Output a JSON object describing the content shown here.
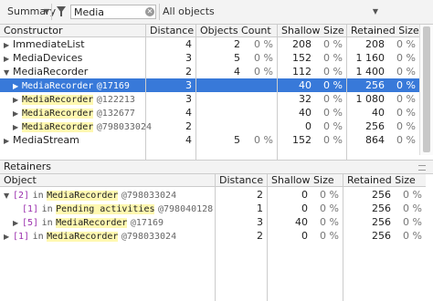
{
  "toolbar": {
    "view": "Summary",
    "filter_value": "Media",
    "class_filter": "All objects"
  },
  "constructors": {
    "headers": {
      "constructor": "Constructor",
      "distance": "Distance",
      "objects_count": "Objects Count",
      "shallow_size": "Shallow Size",
      "retained_size": "Retained Size"
    },
    "rows": [
      {
        "indent": 0,
        "expander": "▶",
        "name": "ImmediateList",
        "highlight": "",
        "addr": "",
        "distance": "4",
        "count": "2",
        "count_pct": "0 %",
        "shallow": "208",
        "shallow_pct": "0 %",
        "retained": "208",
        "retained_pct": "0 %",
        "selected": false
      },
      {
        "indent": 0,
        "expander": "▶",
        "name": "MediaDevices",
        "highlight": "",
        "addr": "",
        "distance": "3",
        "count": "5",
        "count_pct": "0 %",
        "shallow": "152",
        "shallow_pct": "0 %",
        "retained": "1 160",
        "retained_pct": "0 %",
        "selected": false
      },
      {
        "indent": 0,
        "expander": "▼",
        "name": "MediaRecorder",
        "highlight": "",
        "addr": "",
        "distance": "2",
        "count": "4",
        "count_pct": "0 %",
        "shallow": "112",
        "shallow_pct": "0 %",
        "retained": "1 400",
        "retained_pct": "0 %",
        "selected": false
      },
      {
        "indent": 1,
        "expander": "▶",
        "name": "",
        "highlight": "MediaRecorder",
        "addr": "@17169",
        "distance": "3",
        "count": "",
        "count_pct": "",
        "shallow": "40",
        "shallow_pct": "0 %",
        "retained": "256",
        "retained_pct": "0 %",
        "selected": true
      },
      {
        "indent": 1,
        "expander": "▶",
        "name": "",
        "highlight": "MediaRecorder",
        "addr": "@122213",
        "distance": "3",
        "count": "",
        "count_pct": "",
        "shallow": "32",
        "shallow_pct": "0 %",
        "retained": "1 080",
        "retained_pct": "0 %",
        "selected": false
      },
      {
        "indent": 1,
        "expander": "▶",
        "name": "",
        "highlight": "MediaRecorder",
        "addr": "@132677",
        "distance": "4",
        "count": "",
        "count_pct": "",
        "shallow": "40",
        "shallow_pct": "0 %",
        "retained": "40",
        "retained_pct": "0 %",
        "selected": false
      },
      {
        "indent": 1,
        "expander": "▶",
        "name": "",
        "highlight": "MediaRecorder",
        "addr": "@798033024",
        "distance": "2",
        "count": "",
        "count_pct": "",
        "shallow": "0",
        "shallow_pct": "0 %",
        "retained": "256",
        "retained_pct": "0 %",
        "selected": false
      },
      {
        "indent": 0,
        "expander": "▶",
        "name": "MediaStream",
        "highlight": "",
        "addr": "",
        "distance": "4",
        "count": "5",
        "count_pct": "0 %",
        "shallow": "152",
        "shallow_pct": "0 %",
        "retained": "864",
        "retained_pct": "0 %",
        "selected": false
      }
    ]
  },
  "retainers": {
    "title": "Retainers",
    "headers": {
      "object": "Object",
      "distance": "Distance",
      "shallow_size": "Shallow Size",
      "retained_size": "Retained Size"
    },
    "rows": [
      {
        "indent": 0,
        "expander": "▼",
        "index": "[2]",
        "in": "in",
        "highlight": "MediaRecorder",
        "addr": "@798033024",
        "distance": "2",
        "shallow": "0",
        "shallow_pct": "0 %",
        "retained": "256",
        "retained_pct": "0 %"
      },
      {
        "indent": 1,
        "expander": "",
        "index": "[1]",
        "in": "in",
        "highlight": "Pending activities",
        "addr": "@798040128",
        "distance": "1",
        "shallow": "0",
        "shallow_pct": "0 %",
        "retained": "256",
        "retained_pct": "0 %"
      },
      {
        "indent": 1,
        "expander": "▶",
        "index": "[5]",
        "in": "in",
        "highlight": "MediaRecorder",
        "addr": "@17169",
        "distance": "3",
        "shallow": "40",
        "shallow_pct": "0 %",
        "retained": "256",
        "retained_pct": "0 %"
      },
      {
        "indent": 0,
        "expander": "▶",
        "index": "[1]",
        "in": "in",
        "highlight": "MediaRecorder",
        "addr": "@798033024",
        "distance": "2",
        "shallow": "0",
        "shallow_pct": "0 %",
        "retained": "256",
        "retained_pct": "0 %"
      }
    ]
  }
}
